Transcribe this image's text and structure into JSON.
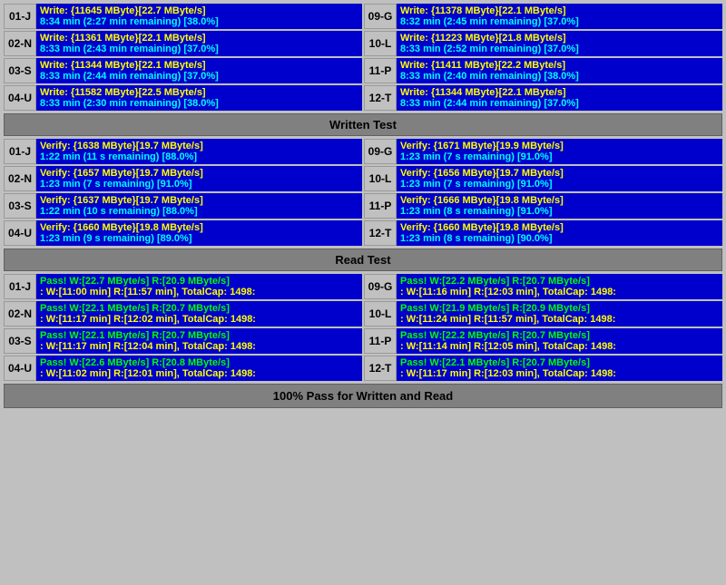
{
  "sections": {
    "write": {
      "header": "Written Test",
      "rows": [
        {
          "left": {
            "label": "01-J",
            "line1": "Write: {11645 MByte}[22.7 MByte/s]",
            "line2": "8:34 min (2:27 min remaining)  [38.0%]"
          },
          "right": {
            "label": "09-G",
            "line1": "Write: {11378 MByte}[22.1 MByte/s]",
            "line2": "8:32 min (2:45 min remaining)  [37.0%]"
          }
        },
        {
          "left": {
            "label": "02-N",
            "line1": "Write: {11361 MByte}[22.1 MByte/s]",
            "line2": "8:33 min (2:43 min remaining)  [37.0%]"
          },
          "right": {
            "label": "10-L",
            "line1": "Write: {11223 MByte}[21.8 MByte/s]",
            "line2": "8:33 min (2:52 min remaining)  [37.0%]"
          }
        },
        {
          "left": {
            "label": "03-S",
            "line1": "Write: {11344 MByte}[22.1 MByte/s]",
            "line2": "8:33 min (2:44 min remaining)  [37.0%]"
          },
          "right": {
            "label": "11-P",
            "line1": "Write: {11411 MByte}[22.2 MByte/s]",
            "line2": "8:33 min (2:40 min remaining)  [38.0%]"
          }
        },
        {
          "left": {
            "label": "04-U",
            "line1": "Write: {11582 MByte}[22.5 MByte/s]",
            "line2": "8:33 min (2:30 min remaining)  [38.0%]"
          },
          "right": {
            "label": "12-T",
            "line1": "Write: {11344 MByte}[22.1 MByte/s]",
            "line2": "8:33 min (2:44 min remaining)  [37.0%]"
          }
        }
      ]
    },
    "verify": {
      "header": "Written Test",
      "rows": [
        {
          "left": {
            "label": "01-J",
            "line1": "Verify: {1638 MByte}[19.7 MByte/s]",
            "line2": "1:22 min (11 s remaining)   [88.0%]"
          },
          "right": {
            "label": "09-G",
            "line1": "Verify: {1671 MByte}[19.9 MByte/s]",
            "line2": "1:23 min (7 s remaining)   [91.0%]"
          }
        },
        {
          "left": {
            "label": "02-N",
            "line1": "Verify: {1657 MByte}[19.7 MByte/s]",
            "line2": "1:23 min (7 s remaining)   [91.0%]"
          },
          "right": {
            "label": "10-L",
            "line1": "Verify: {1656 MByte}[19.7 MByte/s]",
            "line2": "1:23 min (7 s remaining)   [91.0%]"
          }
        },
        {
          "left": {
            "label": "03-S",
            "line1": "Verify: {1637 MByte}[19.7 MByte/s]",
            "line2": "1:22 min (10 s remaining)   [88.0%]"
          },
          "right": {
            "label": "11-P",
            "line1": "Verify: {1666 MByte}[19.8 MByte/s]",
            "line2": "1:23 min (8 s remaining)   [91.0%]"
          }
        },
        {
          "left": {
            "label": "04-U",
            "line1": "Verify: {1660 MByte}[19.8 MByte/s]",
            "line2": "1:23 min (9 s remaining)   [89.0%]"
          },
          "right": {
            "label": "12-T",
            "line1": "Verify: {1660 MByte}[19.8 MByte/s]",
            "line2": "1:23 min (8 s remaining)   [90.0%]"
          }
        }
      ]
    },
    "read": {
      "header": "Read Test",
      "rows": [
        {
          "left": {
            "label": "01-J",
            "line1": "Pass! W:[22.7 MByte/s] R:[20.9 MByte/s]",
            "line2": ": W:[11:00 min] R:[11:57 min], TotalCap: 1498:"
          },
          "right": {
            "label": "09-G",
            "line1": "Pass! W:[22.2 MByte/s] R:[20.7 MByte/s]",
            "line2": ": W:[11:16 min] R:[12:03 min], TotalCap: 1498:"
          }
        },
        {
          "left": {
            "label": "02-N",
            "line1": "Pass! W:[22.1 MByte/s] R:[20.7 MByte/s]",
            "line2": ": W:[11:17 min] R:[12:02 min], TotalCap: 1498:"
          },
          "right": {
            "label": "10-L",
            "line1": "Pass! W:[21.9 MByte/s] R:[20.9 MByte/s]",
            "line2": ": W:[11:24 min] R:[11:57 min], TotalCap: 1498:"
          }
        },
        {
          "left": {
            "label": "03-S",
            "line1": "Pass! W:[22.1 MByte/s] R:[20.7 MByte/s]",
            "line2": ": W:[11:17 min] R:[12:04 min], TotalCap: 1498:"
          },
          "right": {
            "label": "11-P",
            "line1": "Pass! W:[22.2 MByte/s] R:[20.7 MByte/s]",
            "line2": ": W:[11:14 min] R:[12:05 min], TotalCap: 1498:"
          }
        },
        {
          "left": {
            "label": "04-U",
            "line1": "Pass! W:[22.6 MByte/s] R:[20.8 MByte/s]",
            "line2": ": W:[11:02 min] R:[12:01 min], TotalCap: 1498:"
          },
          "right": {
            "label": "12-T",
            "line1": "Pass! W:[22.1 MByte/s] R:[20.7 MByte/s]",
            "line2": ": W:[11:17 min] R:[12:03 min], TotalCap: 1498:"
          }
        }
      ]
    }
  },
  "footer": "100% Pass for Written and Read",
  "header_write": "Written Test",
  "header_read": "Read Test"
}
